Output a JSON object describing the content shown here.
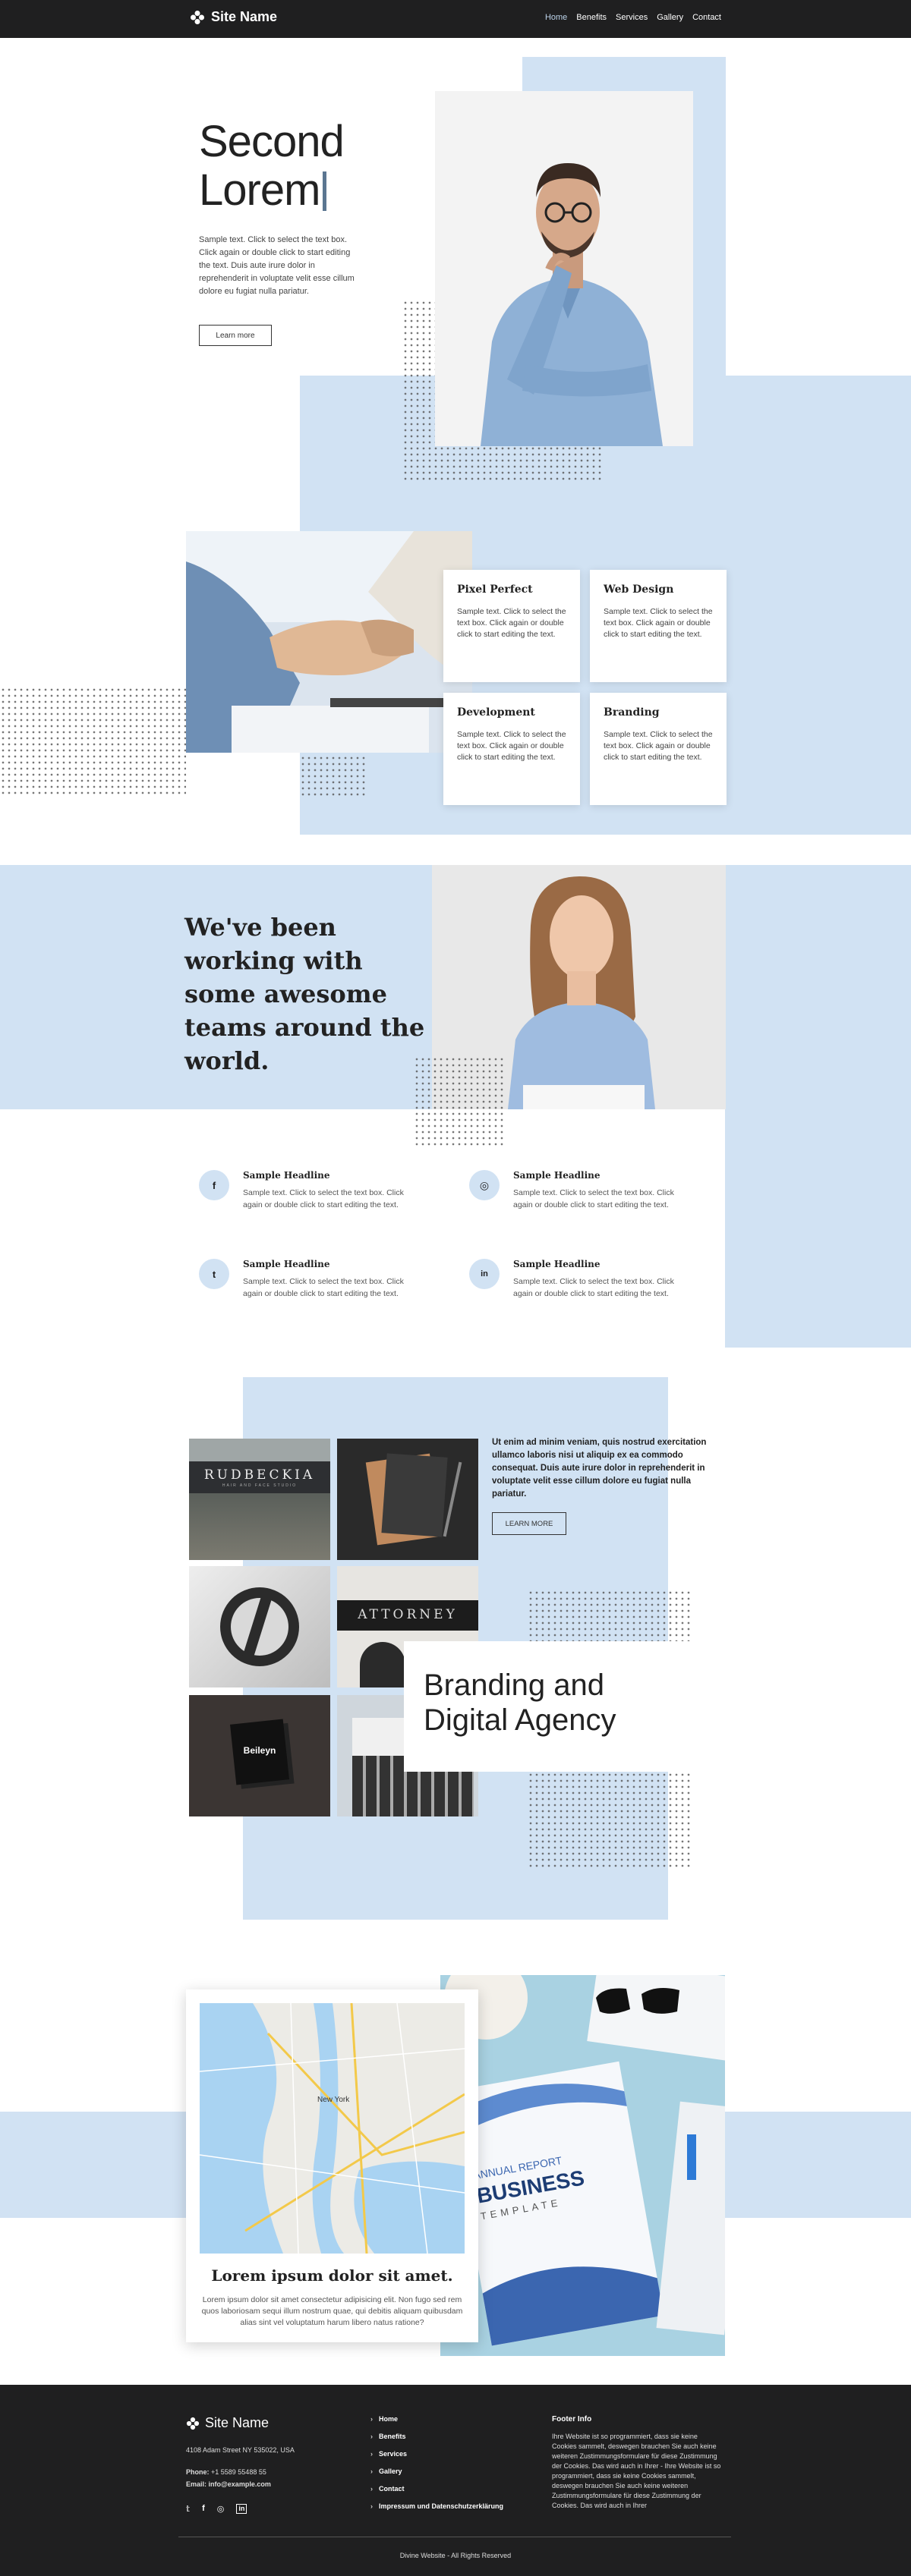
{
  "header": {
    "site_name": "Site Name",
    "nav": [
      "Home",
      "Benefits",
      "Services",
      "Gallery",
      "Contact"
    ]
  },
  "hero": {
    "title_line1": "Second",
    "title_line2": "Lorem",
    "text": "Sample text. Click to select the text box. Click again or double click to start editing the text. Duis aute irure dolor in reprehenderit in voluptate velit esse cillum dolore eu fugiat nulla pariatur.",
    "button": "Learn more"
  },
  "services": [
    {
      "title": "Pixel Perfect",
      "text": "Sample text. Click to select the text box. Click again or double click to start editing the text."
    },
    {
      "title": "Web Design",
      "text": "Sample text. Click to select the text box. Click again or double click to start editing the text."
    },
    {
      "title": "Development",
      "text": "Sample text. Click to select the text box. Click again or double click to start editing the text."
    },
    {
      "title": "Branding",
      "text": "Sample text. Click to select the text box. Click again or double click to start editing the text."
    }
  ],
  "teams": {
    "headline": "We've been working with some awesome teams around the world."
  },
  "features": [
    {
      "icon": "facebook-icon",
      "glyph": "f",
      "title": "Sample Headline",
      "text": "Sample text. Click to select the text box. Click again or double click to start editing the text."
    },
    {
      "icon": "instagram-icon",
      "glyph": "◎",
      "title": "Sample Headline",
      "text": "Sample text. Click to select the text box. Click again or double click to start editing the text."
    },
    {
      "icon": "twitter-icon",
      "glyph": "t",
      "title": "Sample Headline",
      "text": "Sample text. Click to select the text box. Click again or double click to start editing the text."
    },
    {
      "icon": "linkedin-icon",
      "glyph": "in",
      "title": "Sample Headline",
      "text": "Sample text. Click to select the text box. Click again or double click to start editing the text."
    }
  ],
  "gallery": {
    "text": "Ut enim ad minim veniam, quis nostrud exercitation ullamco laboris nisi ut aliquip ex ea commodo consequat. Duis aute irure dolor in reprehenderit in voluptate velit esse cillum dolore eu fugiat nulla pariatur.",
    "button": "LEARN MORE",
    "title_line1": "Branding and",
    "title_line2": "Digital Agency",
    "tile_rudbeckia": "RUDBECKIA",
    "tile_rudbeckia_sub": "HAIR AND FACE STUDIO",
    "tile_attorney": "ATTORNEY",
    "tile_beileyn": "Beileyn"
  },
  "map_section": {
    "map_label": "New York",
    "title": "Lorem ipsum dolor sit amet.",
    "text": "Lorem ipsum dolor sit amet consectetur adipisicing elit. Non fugo sed rem quos laboriosam sequi illum nostrum quae, qui debitis aliquam quibusdam alias sint vel voluptatum harum libero natus ratione?",
    "report_line1": "ANNUAL REPORT",
    "report_line2": "BUSINESS",
    "report_line3": "TEMPLATE"
  },
  "footer": {
    "site_name": "Site Name",
    "address": "4108 Adam Street NY 535022, USA",
    "phone_label": "Phone:",
    "phone": "+1 5589 55488 55",
    "email_label": "Email:",
    "email": "info@example.com",
    "links": [
      "Home",
      "Benefits",
      "Services",
      "Gallery",
      "Contact",
      "Impressum und Datenschutzerklärung"
    ],
    "info_title": "Footer Info",
    "info_text": "Ihre Website ist so programmiert, dass sie keine Cookies sammelt, deswegen brauchen Sie auch keine weiteren Zustimmungsformulare für diese Zustimmung der Cookies. Das wird auch in Ihrer - Ihre Website ist so programmiert, dass sie keine Cookies sammelt, deswegen brauchen Sie auch keine weiteren Zustimmungsformulare für diese Zustimmung der Cookies. Das wird auch in Ihrer",
    "copyright": "Divine Website - All Rights Reserved"
  }
}
